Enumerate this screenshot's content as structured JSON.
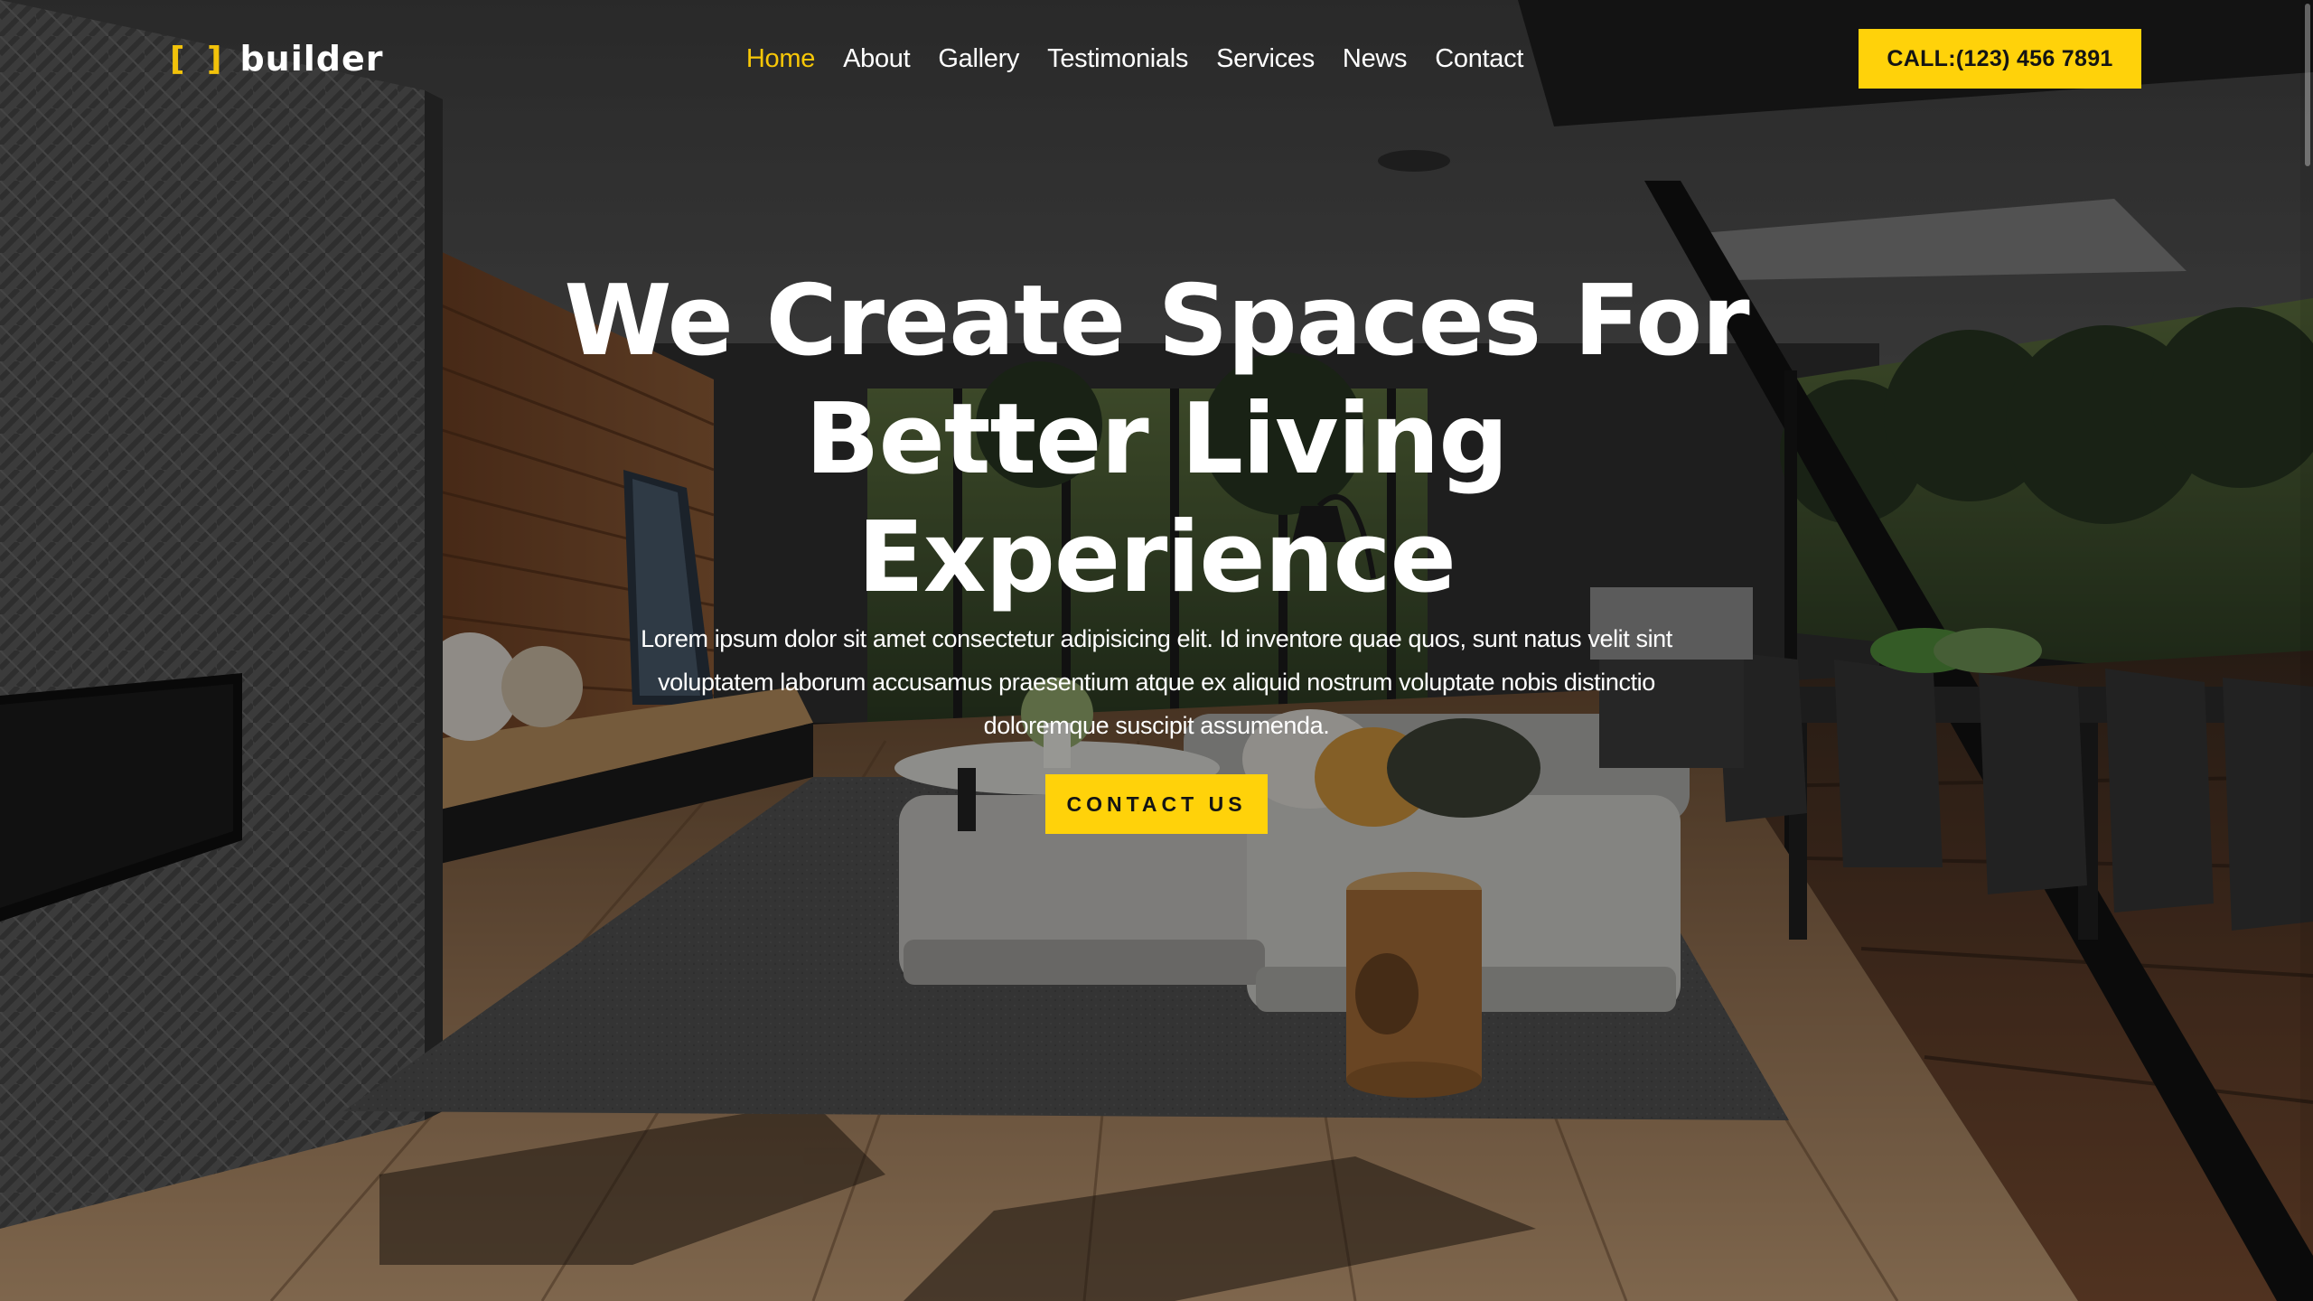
{
  "header": {
    "logo_brackets": "[ ]",
    "logo_text": "builder"
  },
  "nav": {
    "items": [
      "Home",
      "About",
      "Gallery",
      "Testimonials",
      "Services",
      "News",
      "Contact"
    ],
    "active": "Home"
  },
  "call_button": "CALL:(123) 456 7891",
  "hero": {
    "title_lines": [
      "We Create Spaces For",
      "Better Living",
      "Experience"
    ],
    "description": "Lorem ipsum dolor sit amet consectetur adipisicing elit. Id inventore quae quos, sunt natus velit sint voluptatem laborum accusamus praesentium atque ex aliquid nostrum voluptate nobis distinctio doloremque suscipit assumenda.",
    "cta_label": "CONTACT US"
  },
  "colors": {
    "accent": "#ffd20a",
    "active_nav": "#f7c707",
    "text": "#ffffff"
  }
}
